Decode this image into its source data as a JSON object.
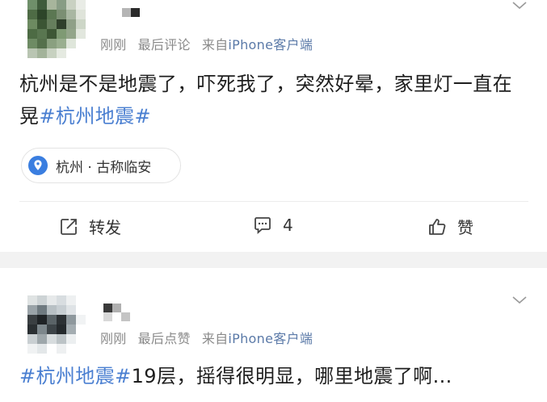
{
  "posts": [
    {
      "meta_time": "刚刚",
      "meta_kind": "最后评论",
      "meta_from": "来自",
      "meta_source": "iPhone客户端",
      "content_text": "杭州是不是地震了，吓死我了，突然好晕，家里灯一直在晃",
      "content_tag": "#杭州地震#",
      "location": "杭州 · 古称临安",
      "actions": {
        "repost_label": "转发",
        "comment_count": "4",
        "like_label": "赞"
      }
    },
    {
      "meta_time": "刚刚",
      "meta_kind": "最后点赞",
      "meta_from": "来自",
      "meta_source": "iPhone客户端",
      "content_tag": "#杭州地震#",
      "content_text": "19层，摇得很明显，哪里地震了啊..."
    }
  ],
  "colors": {
    "link": "#4a7fd1",
    "meta": "#8a8a8a",
    "source": "#5b7aa8",
    "location_pin": "#3a7ee0",
    "separator": "#f2f2f2"
  },
  "icons": {
    "expand": "chevron-down-icon",
    "location": "location-pin-icon",
    "repost": "repost-icon",
    "comment": "comment-icon",
    "like": "thumbs-up-icon"
  }
}
